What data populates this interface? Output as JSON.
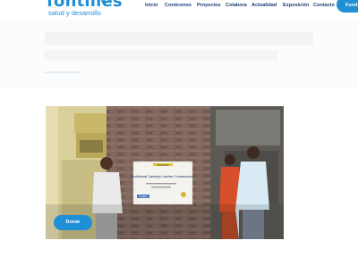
{
  "brand": {
    "name": "fontilles",
    "tagline": "salud y desarrollo"
  },
  "nav": {
    "items": [
      "Inicio",
      "Conócenos",
      "Proyectos",
      "Colabora",
      "Actualidad",
      "Exposición",
      "Contacto"
    ],
    "cta_label": "Fund"
  },
  "photo": {
    "sign_title": "Individual Sanitary Latrine Construction",
    "sign_header": "FONTILLES",
    "sign_footer": "fontilles"
  },
  "donate_label": "Donar",
  "colors": {
    "brand_blue": "#1f8fd6",
    "nav_text": "#1b3b73"
  }
}
